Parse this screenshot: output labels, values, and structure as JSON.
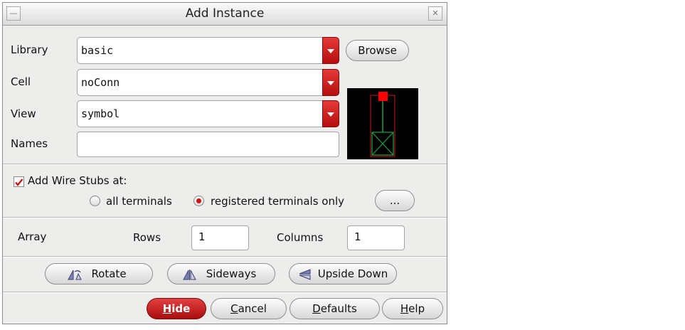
{
  "window": {
    "title": "Add Instance",
    "minimize_glyph": "—",
    "close_glyph": "✕"
  },
  "fields": {
    "library": {
      "label": "Library",
      "value": "basic"
    },
    "cell": {
      "label": "Cell",
      "value": "noConn"
    },
    "view": {
      "label": "View",
      "value": "symbol"
    },
    "names": {
      "label": "Names",
      "value": ""
    }
  },
  "browse_label": "Browse",
  "wire_stubs": {
    "label": "Add Wire Stubs at:",
    "checked": true,
    "option_all": "all terminals",
    "option_registered": "registered terminals only",
    "selected": "registered",
    "more_label": "..."
  },
  "array": {
    "label": "Array",
    "rows_label": "Rows",
    "rows_value": "1",
    "columns_label": "Columns",
    "columns_value": "1"
  },
  "transform": {
    "rotate": "Rotate",
    "sideways": "Sideways",
    "upside_down": "Upside Down"
  },
  "actions": {
    "hide_rest": "ide",
    "hide_mnemonic": "H",
    "cancel_rest": "ancel",
    "cancel_mnemonic": "C",
    "defaults_rest": "efaults",
    "defaults_mnemonic": "D",
    "help_rest": "elp",
    "help_mnemonic": "H"
  },
  "colors": {
    "accent_red": "#c81616",
    "preview_bg": "#000000",
    "pin_red": "#ff0000",
    "symbol_green": "#1aa34a"
  }
}
